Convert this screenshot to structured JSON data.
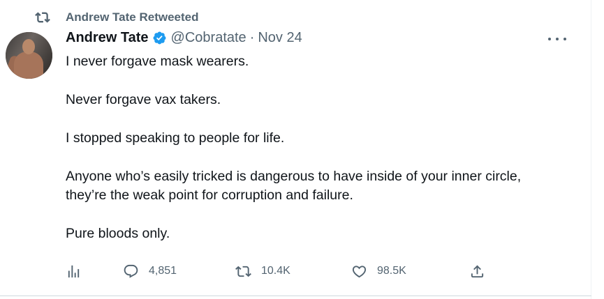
{
  "social_context": {
    "text": "Andrew Tate Retweeted",
    "icon": "retweet-icon"
  },
  "author": {
    "name": "Andrew Tate",
    "handle": "@Cobratate",
    "separator": "·",
    "date": "Nov 24",
    "verified": true,
    "verified_color": "#1d9bf0"
  },
  "tweet": {
    "paragraphs": [
      "I never forgave mask wearers.",
      "Never forgave vax takers.",
      "I stopped speaking to people for life.",
      "Anyone who’s easily tricked is dangerous to have inside of your inner circle, they’re the weak point for corruption and failure.",
      "Pure bloods only."
    ]
  },
  "actions": {
    "analytics": {
      "icon": "analytics-icon"
    },
    "reply": {
      "icon": "reply-icon",
      "count": "4,851"
    },
    "retweet": {
      "icon": "retweet-icon",
      "count": "10.4K"
    },
    "like": {
      "icon": "heart-icon",
      "count": "98.5K"
    },
    "share": {
      "icon": "share-icon"
    }
  },
  "colors": {
    "text": "#0f1419",
    "secondary": "#536471",
    "accent": "#1d9bf0"
  }
}
